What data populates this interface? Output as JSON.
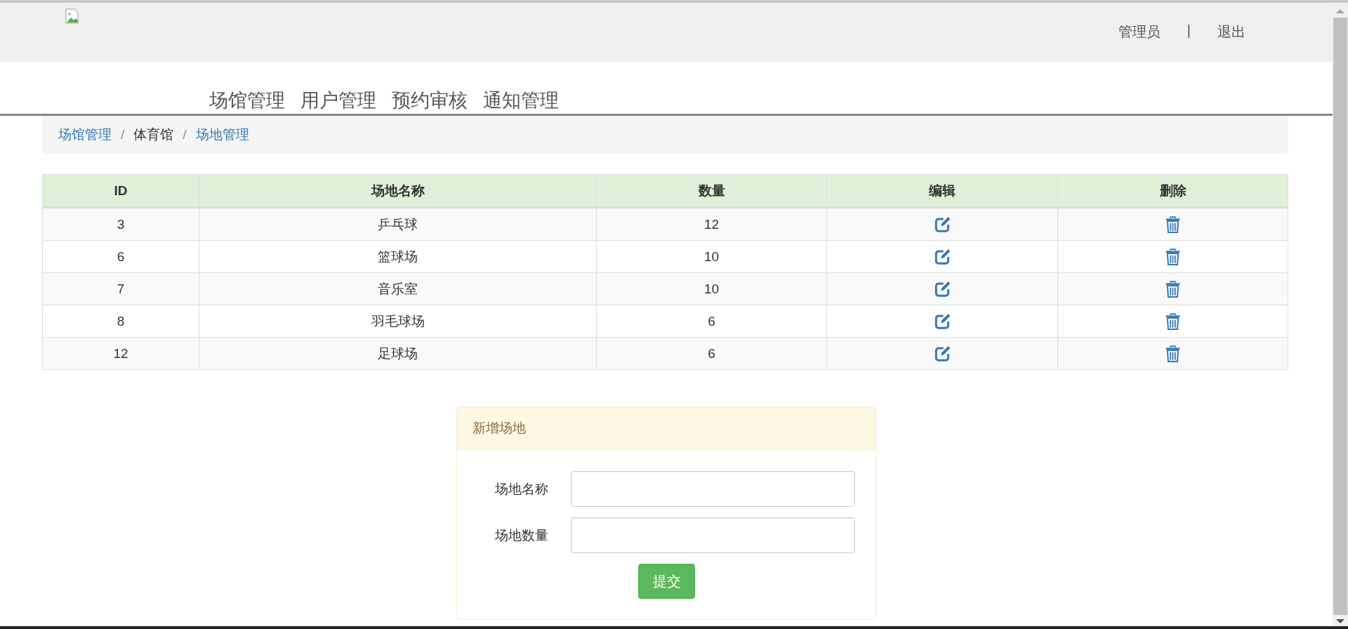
{
  "header": {
    "user": "管理员",
    "divider": "|",
    "logout": "退出"
  },
  "nav": [
    "场馆管理",
    "用户管理",
    "预约审核",
    "通知管理"
  ],
  "breadcrumb": {
    "separator": "/",
    "items": [
      {
        "label": "场馆管理",
        "kind": "link"
      },
      {
        "label": "体育馆",
        "kind": "current"
      },
      {
        "label": "场地管理",
        "kind": "link"
      }
    ]
  },
  "table": {
    "columns": [
      "ID",
      "场地名称",
      "数量",
      "编辑",
      "删除"
    ],
    "rows": [
      {
        "id": "3",
        "name": "乒乓球",
        "count": "12"
      },
      {
        "id": "6",
        "name": "篮球场",
        "count": "10"
      },
      {
        "id": "7",
        "name": "音乐室",
        "count": "10"
      },
      {
        "id": "8",
        "name": "羽毛球场",
        "count": "6"
      },
      {
        "id": "12",
        "name": "足球场",
        "count": "6"
      }
    ]
  },
  "form": {
    "title": "新增场地",
    "fields": [
      {
        "label": "场地名称"
      },
      {
        "label": "场地数量"
      }
    ],
    "submit": "提交"
  }
}
